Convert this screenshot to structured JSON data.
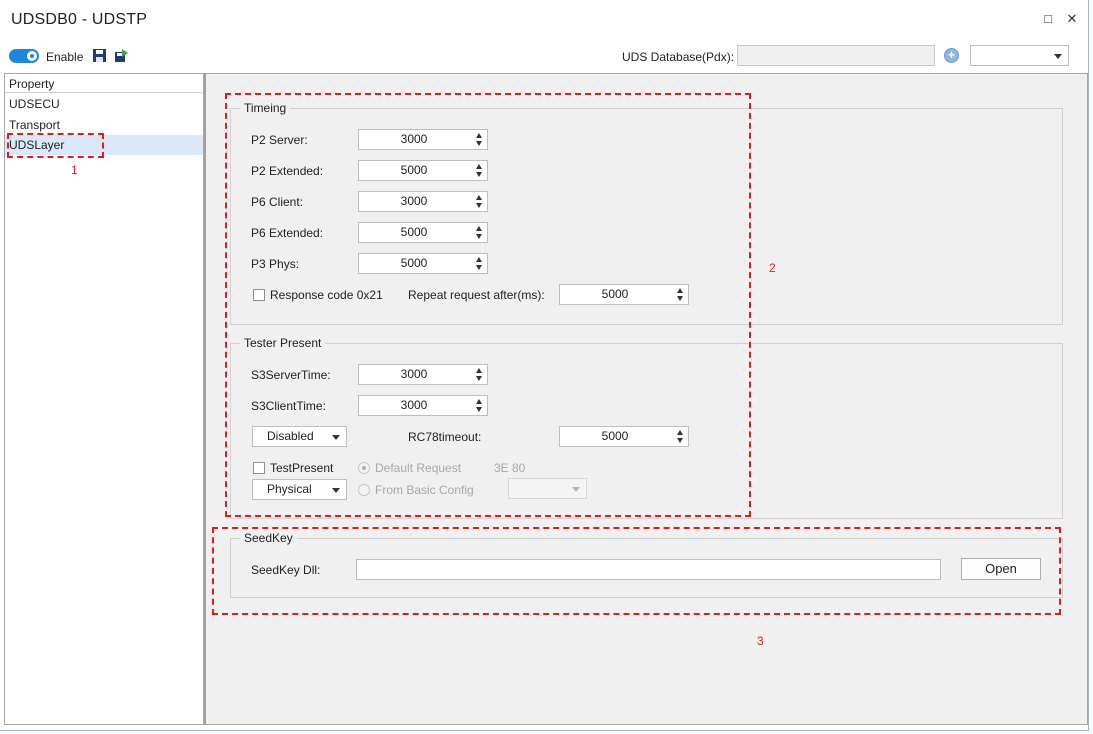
{
  "window": {
    "title": "UDSDB0 - UDSTP",
    "maximize_glyph": "□",
    "close_glyph": "✕"
  },
  "toolbar": {
    "enable_label": "Enable",
    "enabled": true,
    "pdx_label": "UDS Database(Pdx):",
    "pdx_value": "",
    "add_glyph": "+",
    "database_select_value": "",
    "icons": [
      "save-icon",
      "export-icon",
      "add-circle-icon",
      "toggle-icon"
    ]
  },
  "sidebar": {
    "header": "Property",
    "items": [
      {
        "label": "UDSECU",
        "selected": false
      },
      {
        "label": "Transport",
        "selected": false
      },
      {
        "label": "UDSLayer",
        "selected": true
      }
    ]
  },
  "timing": {
    "title": "Timeing",
    "rows": [
      {
        "label": "P2 Server:",
        "value": "3000"
      },
      {
        "label": "P2 Extended:",
        "value": "5000"
      },
      {
        "label": "P6 Client:",
        "value": "3000"
      },
      {
        "label": "P6 Extended:",
        "value": "5000"
      },
      {
        "label": "P3 Phys:",
        "value": "5000"
      }
    ],
    "response_code_label": "Response code 0x21",
    "response_code_checked": false,
    "repeat_label": "Repeat request after(ms):",
    "repeat_value": "5000"
  },
  "tester_present": {
    "title": "Tester Present",
    "s3_server_label": "S3ServerTime:",
    "s3_server_value": "3000",
    "s3_client_label": "S3ClientTime:",
    "s3_client_value": "3000",
    "mode_value": "Disabled",
    "rc78_label": "RC78timeout:",
    "rc78_value": "5000",
    "testpresent_label": "TestPresent",
    "testpresent_checked": false,
    "default_request_label": "Default Request",
    "default_request_value": "3E 80",
    "addressing_value": "Physical",
    "from_basic_label": "From Basic Config",
    "from_basic_value": ""
  },
  "seedkey": {
    "title": "SeedKey",
    "dll_label": "SeedKey Dll:",
    "dll_value": "",
    "open_label": "Open"
  },
  "annotations": {
    "box1": "1",
    "box2": "2",
    "box3": "3",
    "color": "#e01c1c"
  },
  "colors": {
    "accent": "#1e88d8",
    "panel_bg": "#f0f0f0",
    "selected_bg": "#dbe8f7"
  }
}
